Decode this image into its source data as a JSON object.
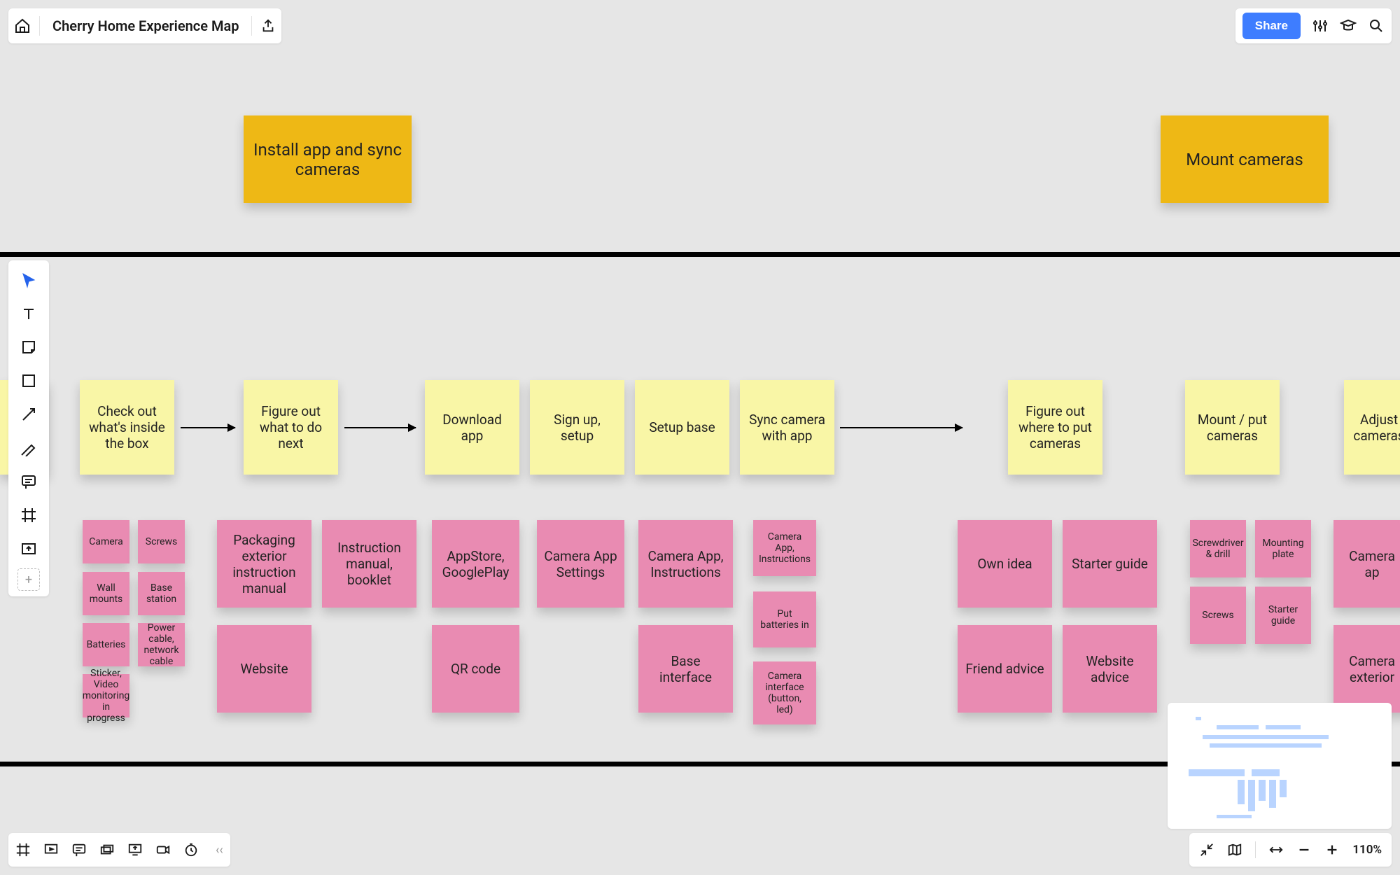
{
  "header": {
    "title": "Cherry Home Experience Map",
    "share_label": "Share"
  },
  "zoom": {
    "level": "110%"
  },
  "gold_notes": {
    "install": "Install app and sync cameras",
    "mount": "Mount cameras"
  },
  "yellow_notes": {
    "edge_left": "...",
    "check_box": "Check out what's inside the box",
    "figure_next": "Figure out what to do next",
    "download": "Download app",
    "signup": "Sign up, setup",
    "setup_base": "Setup base",
    "sync": "Sync camera with app",
    "figure_where": "Figure out where to put cameras",
    "mount_put": "Mount / put cameras",
    "adjust": "Adjust cameras"
  },
  "pink_small": {
    "camera": "Camera",
    "screws": "Screws",
    "wall_mounts": "Wall mounts",
    "base_station": "Base station",
    "batteries": "Batteries",
    "power_cable": "Power cable, network cable",
    "sticker": "Sticker, Video monitoring in progress",
    "screwdriver": "Screwdriver & drill",
    "mount_plate": "Mounting plate",
    "screws2": "Screws",
    "starter2": "Starter guide"
  },
  "pink_big": {
    "packaging": "Packaging exterior instruction manual",
    "manual": "Instruction manual, booklet",
    "website": "Website",
    "appstore": "AppStore, GooglePlay",
    "qr": "QR code",
    "cam_settings": "Camera App Settings",
    "cam_instructions": "Camera App, Instructions",
    "base_interface": "Base interface",
    "cam_app_instr2": "Camera App, Instructions",
    "put_batteries": "Put batteries in",
    "cam_interface": "Camera interface (button, led)",
    "own_idea": "Own idea",
    "starter_guide": "Starter guide",
    "friend_advice": "Friend advice",
    "website_advice": "Website advice",
    "camera_app_r": "Camera ap",
    "camera_ext_r": "Camera exterior"
  }
}
